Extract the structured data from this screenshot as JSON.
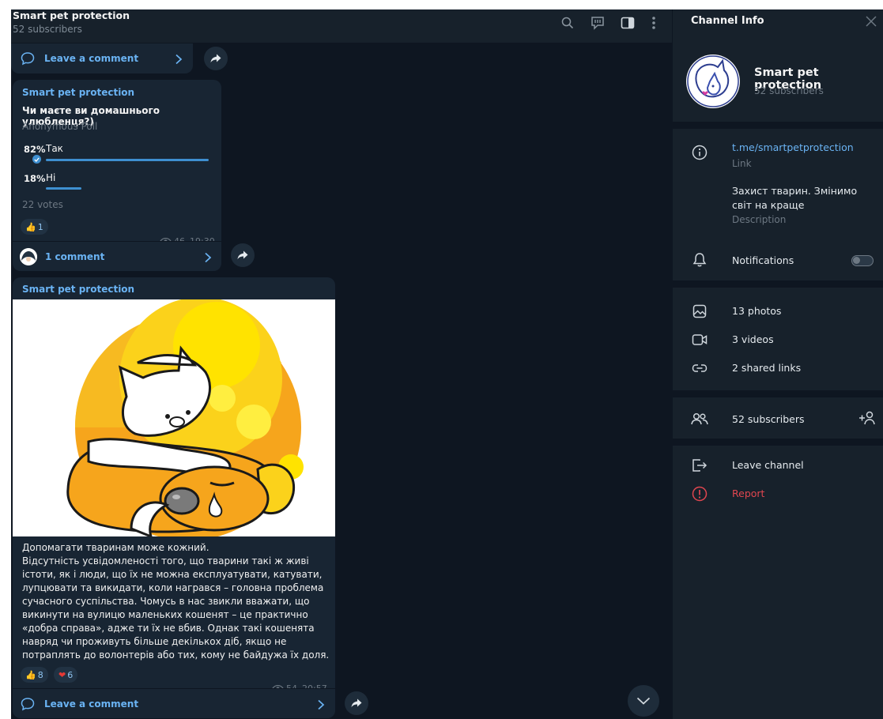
{
  "chat_header": {
    "title": "Smart pet protection",
    "subtitle": "52 subscribers"
  },
  "top_comment_bar": {
    "label": "Leave a comment"
  },
  "poll_post": {
    "author": "Smart pet protection",
    "question": "Чи маєте ви домашнього улюбленця?)",
    "poll_type": "Anonymous Poll",
    "options": [
      {
        "percent": "82%",
        "label": "Так",
        "value": 82,
        "chosen": true
      },
      {
        "percent": "18%",
        "label": "Ні",
        "value": 18,
        "chosen": false
      }
    ],
    "votes": "22 votes",
    "reaction": {
      "emoji": "👍",
      "count": "1"
    },
    "views": "46",
    "time": "19:30",
    "comments_label": "1 comment"
  },
  "image_post": {
    "author": "Smart pet protection",
    "text": "Допомагати тваринам може кожний.\nВідсутність усвідомленості того, що тварини  такі ж живі істоти, як і люди, що їх не можна експлуатувати, катувати, лупцювати та викидати, коли награвся – головна проблема сучасного суспільства. Чомусь в нас звикли вважати, що викинути на вулицю маленьких кошенят – це практично «добра справа», адже ти їх не вбив. Однак такі кошенята навряд чи проживуть більше декількох діб, якщо не потраплять до волонтерів або тих, кому не байдужа їх доля.",
    "reactions": [
      {
        "emoji": "👍",
        "count": "8"
      },
      {
        "emoji": "❤",
        "count": "6"
      }
    ],
    "views": "54",
    "time": "20:57",
    "comment_label": "Leave a comment"
  },
  "info_panel": {
    "title": "Channel Info",
    "channel_name": "Smart pet protection",
    "subscribers": "52 subscribers",
    "link": "t.me/smartpetprotection",
    "link_caption": "Link",
    "description": "Захист тварин. Змінимо світ на краще",
    "description_caption": "Description",
    "notifications_label": "Notifications",
    "notifications_on": false,
    "media": {
      "photos": "13 photos",
      "videos": "3 videos",
      "links": "2 shared links"
    },
    "members_label": "52 subscribers",
    "leave_label": "Leave channel",
    "report_label": "Report"
  },
  "colors": {
    "background": "#0e1621",
    "panel": "#17212b",
    "bubble": "#182533",
    "accent": "#6ab3f3",
    "poll_bar": "#3e8fd0",
    "danger": "#e0464f"
  },
  "icons": [
    "search-icon",
    "live-chat-icon",
    "sidebar-toggle-icon",
    "more-vert-icon",
    "comment-icon",
    "chevron-right-icon",
    "forward-icon",
    "eye-icon",
    "check-icon",
    "chevron-down-icon",
    "close-icon",
    "info-icon",
    "bell-icon",
    "photo-icon",
    "video-icon",
    "link-icon",
    "users-icon",
    "add-user-icon",
    "leave-icon",
    "report-icon"
  ]
}
